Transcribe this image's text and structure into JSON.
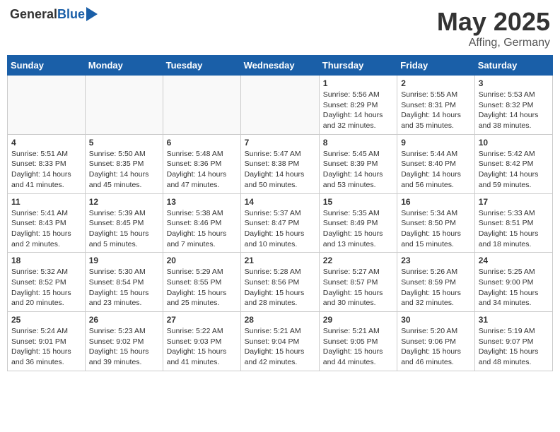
{
  "header": {
    "logo_general": "General",
    "logo_blue": "Blue",
    "title": "May 2025",
    "location": "Affing, Germany"
  },
  "weekdays": [
    "Sunday",
    "Monday",
    "Tuesday",
    "Wednesday",
    "Thursday",
    "Friday",
    "Saturday"
  ],
  "weeks": [
    [
      {
        "day": "",
        "info": ""
      },
      {
        "day": "",
        "info": ""
      },
      {
        "day": "",
        "info": ""
      },
      {
        "day": "",
        "info": ""
      },
      {
        "day": "1",
        "info": "Sunrise: 5:56 AM\nSunset: 8:29 PM\nDaylight: 14 hours\nand 32 minutes."
      },
      {
        "day": "2",
        "info": "Sunrise: 5:55 AM\nSunset: 8:31 PM\nDaylight: 14 hours\nand 35 minutes."
      },
      {
        "day": "3",
        "info": "Sunrise: 5:53 AM\nSunset: 8:32 PM\nDaylight: 14 hours\nand 38 minutes."
      }
    ],
    [
      {
        "day": "4",
        "info": "Sunrise: 5:51 AM\nSunset: 8:33 PM\nDaylight: 14 hours\nand 41 minutes."
      },
      {
        "day": "5",
        "info": "Sunrise: 5:50 AM\nSunset: 8:35 PM\nDaylight: 14 hours\nand 45 minutes."
      },
      {
        "day": "6",
        "info": "Sunrise: 5:48 AM\nSunset: 8:36 PM\nDaylight: 14 hours\nand 47 minutes."
      },
      {
        "day": "7",
        "info": "Sunrise: 5:47 AM\nSunset: 8:38 PM\nDaylight: 14 hours\nand 50 minutes."
      },
      {
        "day": "8",
        "info": "Sunrise: 5:45 AM\nSunset: 8:39 PM\nDaylight: 14 hours\nand 53 minutes."
      },
      {
        "day": "9",
        "info": "Sunrise: 5:44 AM\nSunset: 8:40 PM\nDaylight: 14 hours\nand 56 minutes."
      },
      {
        "day": "10",
        "info": "Sunrise: 5:42 AM\nSunset: 8:42 PM\nDaylight: 14 hours\nand 59 minutes."
      }
    ],
    [
      {
        "day": "11",
        "info": "Sunrise: 5:41 AM\nSunset: 8:43 PM\nDaylight: 15 hours\nand 2 minutes."
      },
      {
        "day": "12",
        "info": "Sunrise: 5:39 AM\nSunset: 8:45 PM\nDaylight: 15 hours\nand 5 minutes."
      },
      {
        "day": "13",
        "info": "Sunrise: 5:38 AM\nSunset: 8:46 PM\nDaylight: 15 hours\nand 7 minutes."
      },
      {
        "day": "14",
        "info": "Sunrise: 5:37 AM\nSunset: 8:47 PM\nDaylight: 15 hours\nand 10 minutes."
      },
      {
        "day": "15",
        "info": "Sunrise: 5:35 AM\nSunset: 8:49 PM\nDaylight: 15 hours\nand 13 minutes."
      },
      {
        "day": "16",
        "info": "Sunrise: 5:34 AM\nSunset: 8:50 PM\nDaylight: 15 hours\nand 15 minutes."
      },
      {
        "day": "17",
        "info": "Sunrise: 5:33 AM\nSunset: 8:51 PM\nDaylight: 15 hours\nand 18 minutes."
      }
    ],
    [
      {
        "day": "18",
        "info": "Sunrise: 5:32 AM\nSunset: 8:52 PM\nDaylight: 15 hours\nand 20 minutes."
      },
      {
        "day": "19",
        "info": "Sunrise: 5:30 AM\nSunset: 8:54 PM\nDaylight: 15 hours\nand 23 minutes."
      },
      {
        "day": "20",
        "info": "Sunrise: 5:29 AM\nSunset: 8:55 PM\nDaylight: 15 hours\nand 25 minutes."
      },
      {
        "day": "21",
        "info": "Sunrise: 5:28 AM\nSunset: 8:56 PM\nDaylight: 15 hours\nand 28 minutes."
      },
      {
        "day": "22",
        "info": "Sunrise: 5:27 AM\nSunset: 8:57 PM\nDaylight: 15 hours\nand 30 minutes."
      },
      {
        "day": "23",
        "info": "Sunrise: 5:26 AM\nSunset: 8:59 PM\nDaylight: 15 hours\nand 32 minutes."
      },
      {
        "day": "24",
        "info": "Sunrise: 5:25 AM\nSunset: 9:00 PM\nDaylight: 15 hours\nand 34 minutes."
      }
    ],
    [
      {
        "day": "25",
        "info": "Sunrise: 5:24 AM\nSunset: 9:01 PM\nDaylight: 15 hours\nand 36 minutes."
      },
      {
        "day": "26",
        "info": "Sunrise: 5:23 AM\nSunset: 9:02 PM\nDaylight: 15 hours\nand 39 minutes."
      },
      {
        "day": "27",
        "info": "Sunrise: 5:22 AM\nSunset: 9:03 PM\nDaylight: 15 hours\nand 41 minutes."
      },
      {
        "day": "28",
        "info": "Sunrise: 5:21 AM\nSunset: 9:04 PM\nDaylight: 15 hours\nand 42 minutes."
      },
      {
        "day": "29",
        "info": "Sunrise: 5:21 AM\nSunset: 9:05 PM\nDaylight: 15 hours\nand 44 minutes."
      },
      {
        "day": "30",
        "info": "Sunrise: 5:20 AM\nSunset: 9:06 PM\nDaylight: 15 hours\nand 46 minutes."
      },
      {
        "day": "31",
        "info": "Sunrise: 5:19 AM\nSunset: 9:07 PM\nDaylight: 15 hours\nand 48 minutes."
      }
    ]
  ]
}
